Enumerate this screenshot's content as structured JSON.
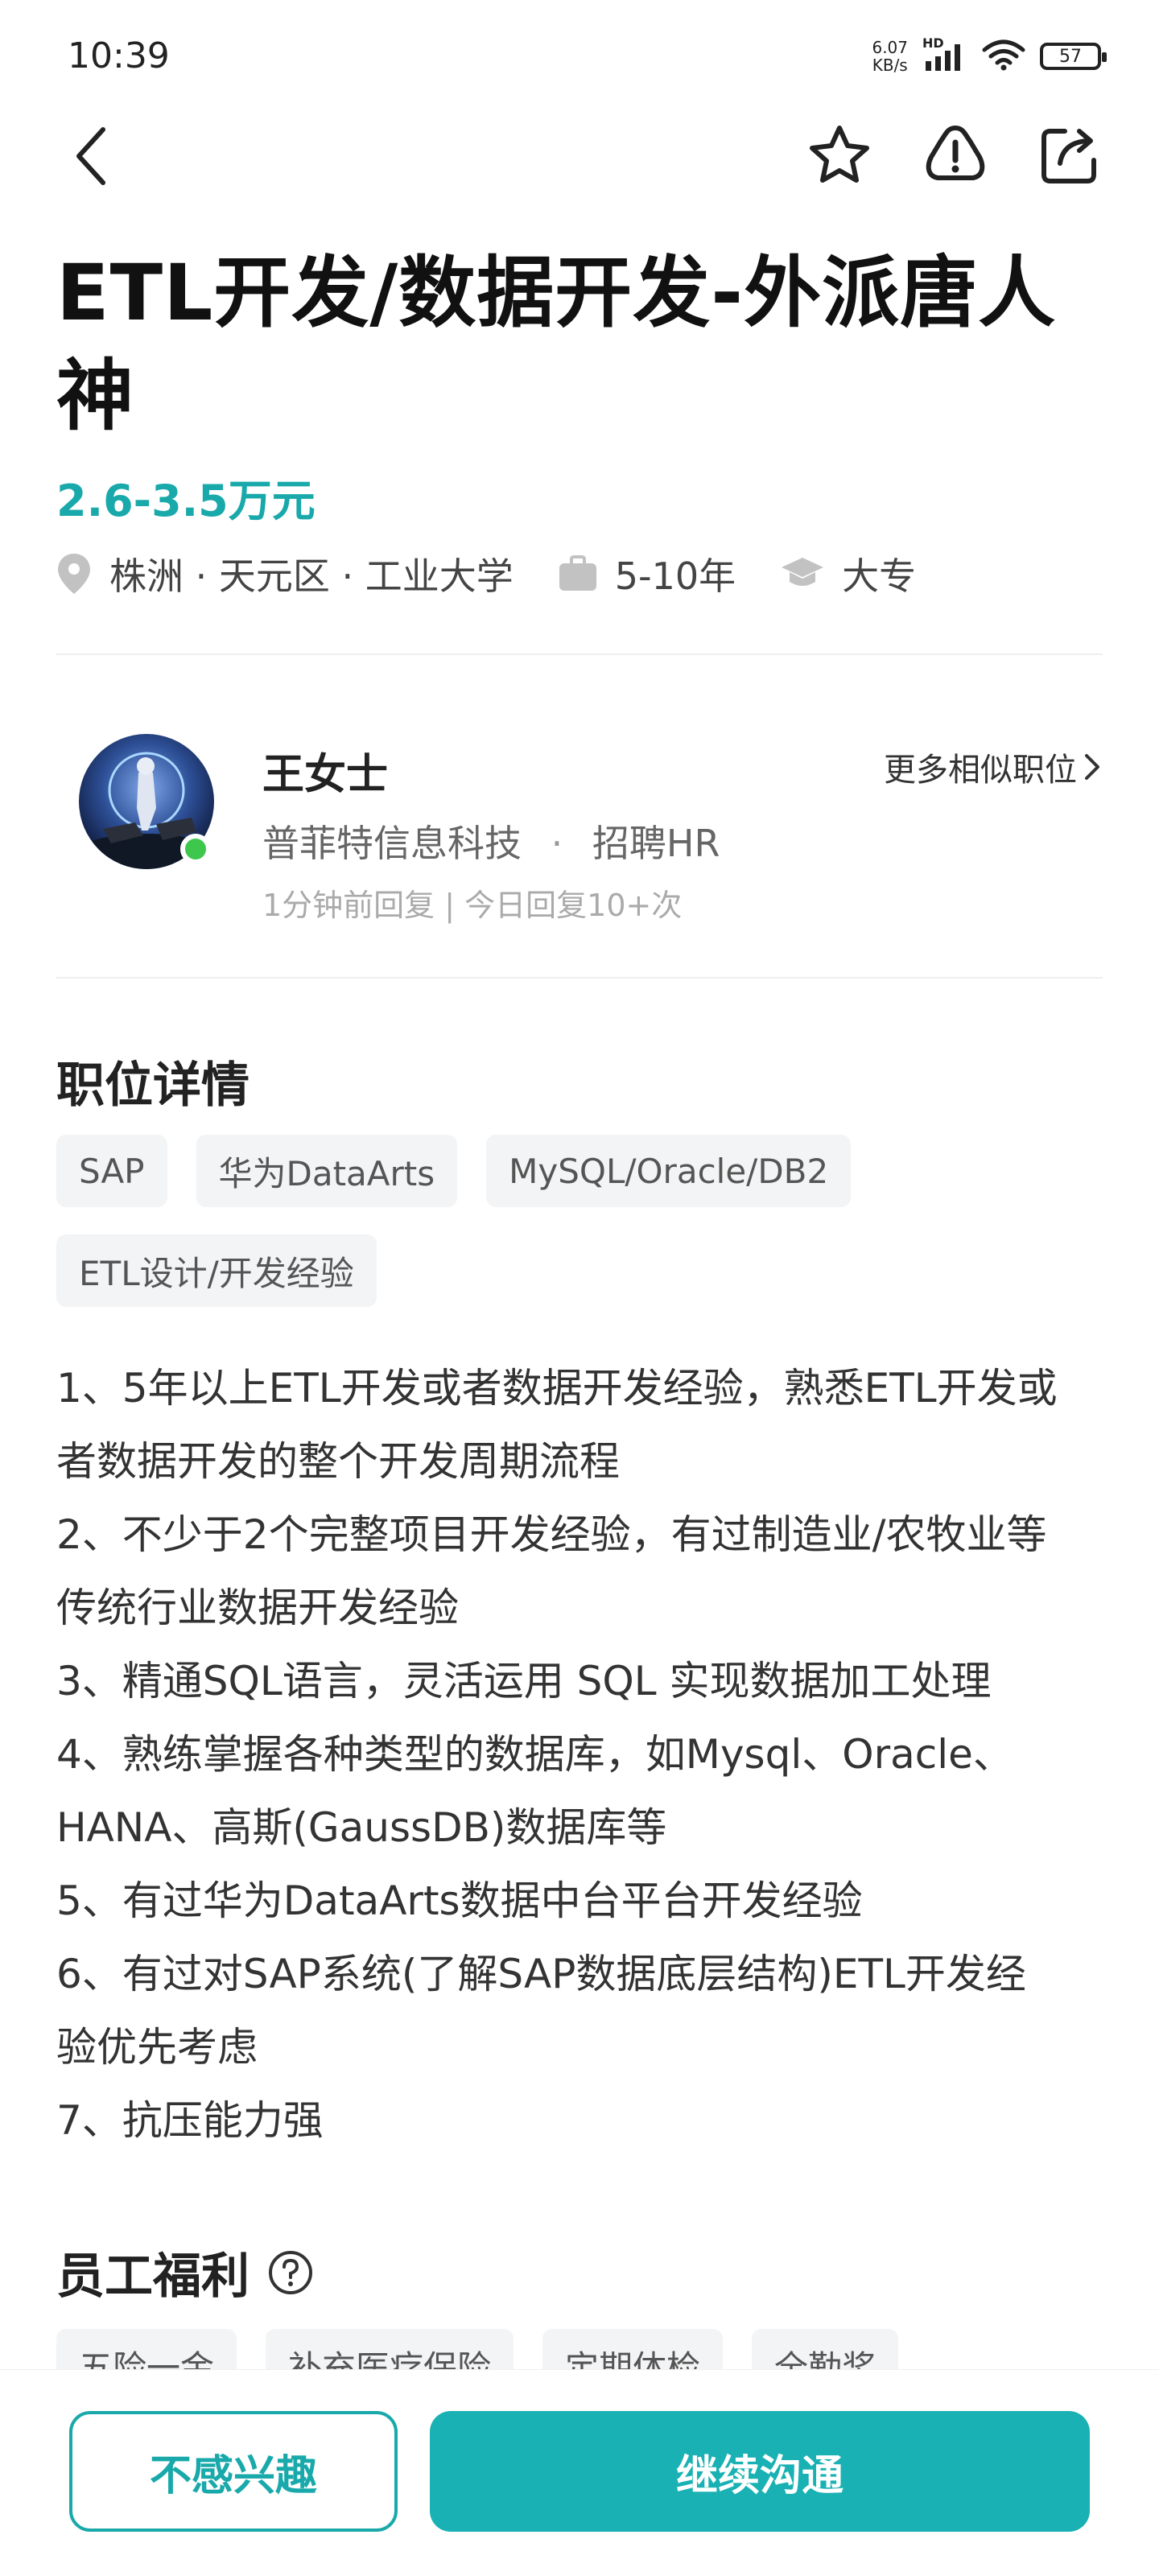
{
  "status_bar": {
    "time": "10:39",
    "net_speed_value": "6.07",
    "net_speed_unit": "KB/s",
    "hd_label": "HD",
    "battery": "57"
  },
  "job": {
    "title": "ETL开发/数据开发-外派唐人神",
    "salary": "2.6-3.5万元",
    "location": "株洲 · 天元区 · 工业大学",
    "experience": "5-10年",
    "education": "大专"
  },
  "recruiter": {
    "name": "王女士",
    "company": "普菲特信息科技",
    "separator": "·",
    "role": "招聘HR",
    "reply_info": "1分钟前回复 | 今日回复10+次",
    "more_similar": "更多相似职位"
  },
  "details": {
    "section_title": "职位详情",
    "tags": [
      "SAP",
      "华为DataArts",
      "MySQL/Oracle/DB2",
      "ETL设计/开发经验"
    ],
    "description_lines": [
      "1、5年以上ETL开发或者数据开发经验，熟悉ETL开发或",
      "者数据开发的整个开发周期流程",
      "2、不少于2个完整项目开发经验，有过制造业/农牧业等",
      "传统行业数据开发经验",
      "3、精通SQL语言，灵活运用 SQL 实现数据加工处理",
      "4、熟练掌握各种类型的数据库，如Mysql、Oracle、",
      "HANA、高斯(GaussDB)数据库等",
      "5、有过华为DataArts数据中台平台开发经验",
      "6、有过对SAP系统(了解SAP数据底层结构)ETL开发经",
      "验优先考虑",
      "7、抗压能力强"
    ]
  },
  "benefits": {
    "section_title": "员工福利",
    "tags": [
      "五险一金",
      "补充医疗保险",
      "定期体检",
      "全勤奖"
    ]
  },
  "actions": {
    "not_interested": "不感兴趣",
    "continue_chat": "继续沟通"
  },
  "colors": {
    "accent": "#19a9ab",
    "primary_button": "#19b1b3",
    "online": "#3dc84d"
  }
}
